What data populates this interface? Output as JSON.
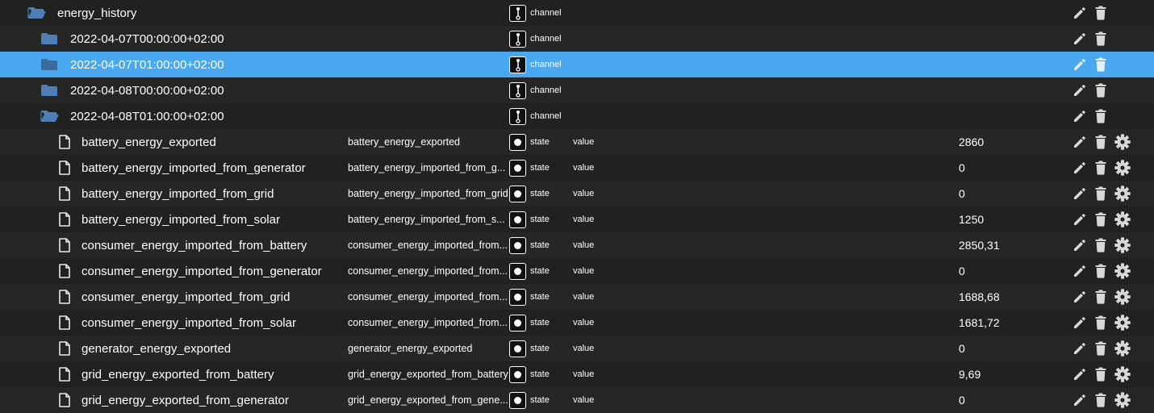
{
  "colors": {
    "background": "#212121",
    "row_alt": "#262626",
    "selected": "#4aa8f0",
    "folder": "#4f7fb4",
    "icon": "#d8d8d8"
  },
  "channel_rows": [
    {
      "name": "energy_history",
      "type": "channel",
      "icon": "folder-open-icon"
    },
    {
      "name": "2022-04-07T00:00:00+02:00",
      "type": "channel",
      "icon": "folder-icon"
    },
    {
      "name": "2022-04-07T01:00:00+02:00",
      "type": "channel",
      "icon": "folder-icon",
      "selected": true
    },
    {
      "name": "2022-04-08T00:00:00+02:00",
      "type": "channel",
      "icon": "folder-icon"
    },
    {
      "name": "2022-04-08T01:00:00+02:00",
      "type": "channel",
      "icon": "folder-open-icon"
    }
  ],
  "state_rows": [
    {
      "name": "battery_energy_exported",
      "role_name": "battery_energy_exported",
      "type": "state",
      "role": "value",
      "value": "2860"
    },
    {
      "name": "battery_energy_imported_from_generator",
      "role_name": "battery_energy_imported_from_generator",
      "type": "state",
      "role": "value",
      "value": "0"
    },
    {
      "name": "battery_energy_imported_from_grid",
      "role_name": "battery_energy_imported_from_grid",
      "type": "state",
      "role": "value",
      "value": "0"
    },
    {
      "name": "battery_energy_imported_from_solar",
      "role_name": "battery_energy_imported_from_solar",
      "type": "state",
      "role": "value",
      "value": "1250"
    },
    {
      "name": "consumer_energy_imported_from_battery",
      "role_name": "consumer_energy_imported_from_battery",
      "type": "state",
      "role": "value",
      "value": "2850,31"
    },
    {
      "name": "consumer_energy_imported_from_generator",
      "role_name": "consumer_energy_imported_from_generator",
      "type": "state",
      "role": "value",
      "value": "0"
    },
    {
      "name": "consumer_energy_imported_from_grid",
      "role_name": "consumer_energy_imported_from_grid",
      "type": "state",
      "role": "value",
      "value": "1688,68"
    },
    {
      "name": "consumer_energy_imported_from_solar",
      "role_name": "consumer_energy_imported_from_solar",
      "type": "state",
      "role": "value",
      "value": "1681,72"
    },
    {
      "name": "generator_energy_exported",
      "role_name": "generator_energy_exported",
      "type": "state",
      "role": "value",
      "value": "0"
    },
    {
      "name": "grid_energy_exported_from_battery",
      "role_name": "grid_energy_exported_from_battery",
      "type": "state",
      "role": "value",
      "value": "9,69"
    },
    {
      "name": "grid_energy_exported_from_generator",
      "role_name": "grid_energy_exported_from_generator",
      "type": "state",
      "role": "value",
      "value": "0"
    }
  ]
}
